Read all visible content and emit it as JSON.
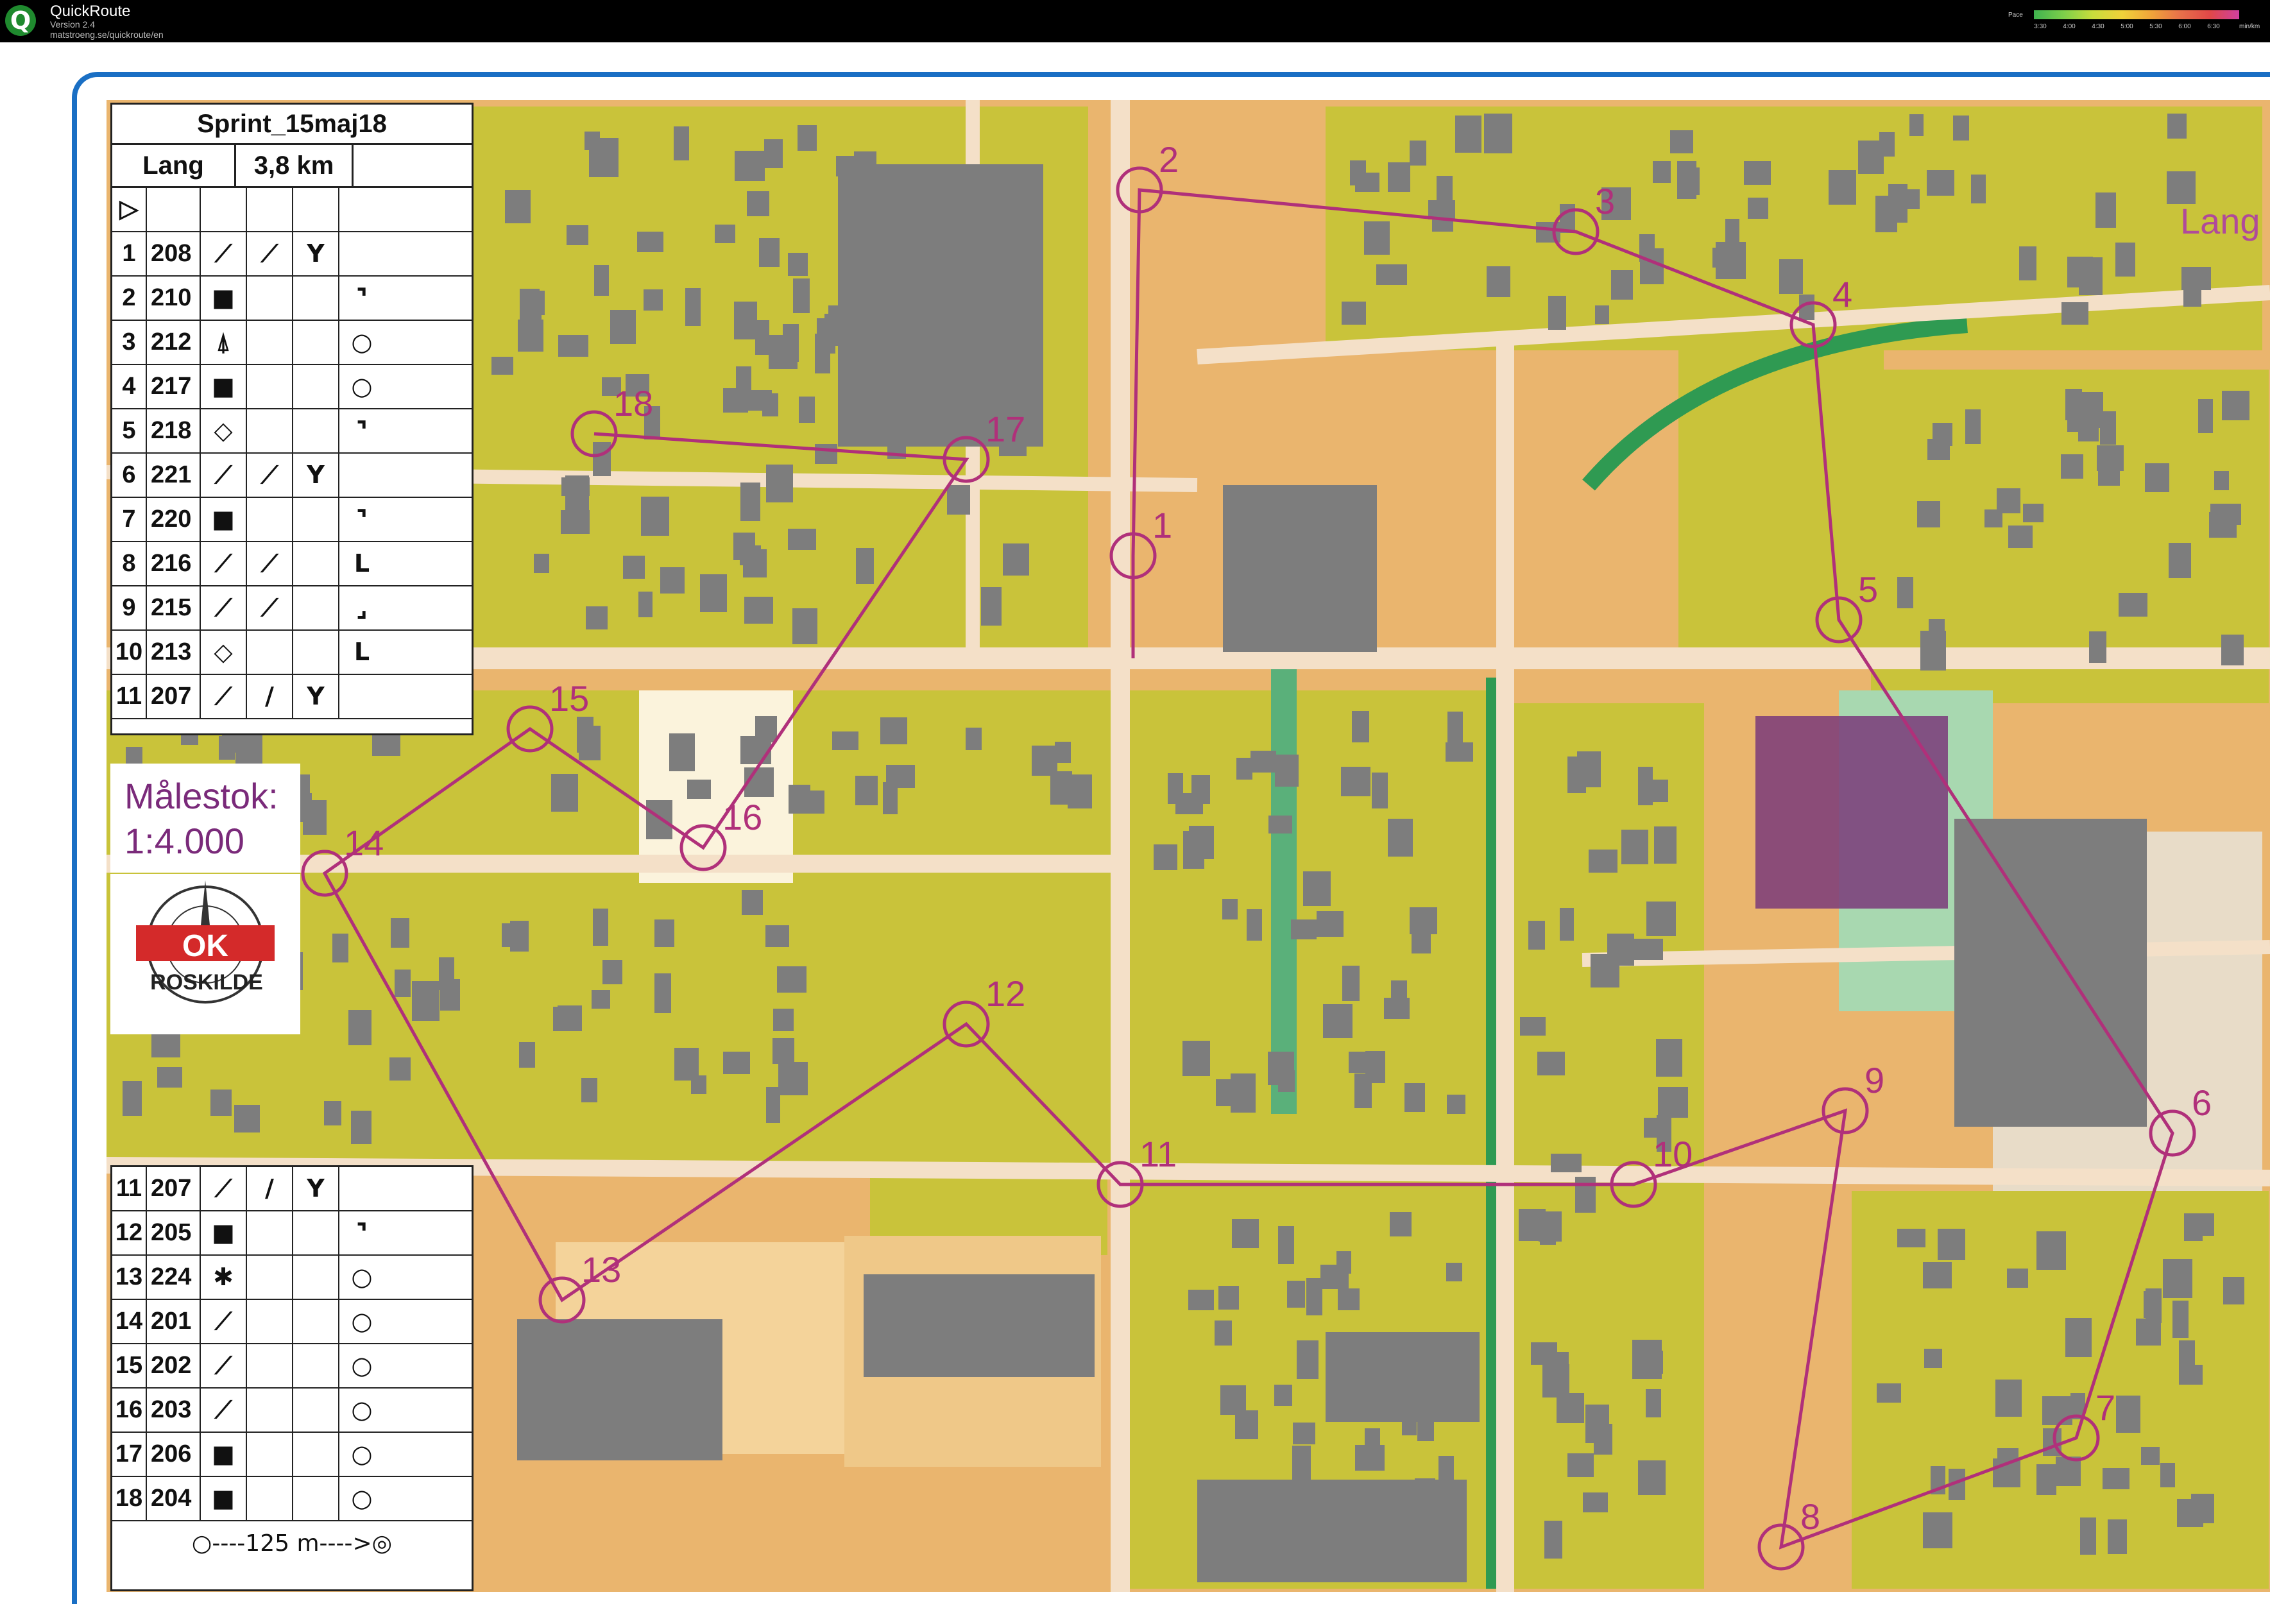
{
  "app": {
    "title": "QuickRoute",
    "version": "Version 2.4",
    "url": "matstroeng.se/quickroute/en",
    "logo_letter": "Q"
  },
  "pace_legend": {
    "label": "Pace",
    "ticks": [
      "3:30",
      "4:00",
      "4:30",
      "5:00",
      "5:30",
      "6:00",
      "6:30"
    ],
    "unit": "min/km"
  },
  "map_sheet": {
    "course_label": "Lang",
    "scale_label": "Målestok:",
    "scale_value": "1:4.000",
    "club_name": "ROSKILDE",
    "club_logo_letters": "OK"
  },
  "control_card": {
    "title": "Sprint_15maj18",
    "class": "Lang",
    "distance": "3,8 km",
    "start_symbol": "▷",
    "rows_top": [
      {
        "n": "1",
        "code": "208",
        "s": [
          "⟋",
          "⟋",
          "Y",
          ""
        ]
      },
      {
        "n": "2",
        "code": "210",
        "s": [
          "■",
          "",
          "",
          "⌝"
        ]
      },
      {
        "n": "3",
        "code": "212",
        "s": [
          "⍋",
          "",
          "",
          "○"
        ]
      },
      {
        "n": "4",
        "code": "217",
        "s": [
          "■",
          "",
          "",
          "○"
        ]
      },
      {
        "n": "5",
        "code": "218",
        "s": [
          "◇",
          "",
          "",
          "⌝"
        ]
      },
      {
        "n": "6",
        "code": "221",
        "s": [
          "⟋",
          "⟋",
          "Y",
          ""
        ]
      },
      {
        "n": "7",
        "code": "220",
        "s": [
          "■",
          "",
          "",
          "⌝"
        ]
      },
      {
        "n": "8",
        "code": "216",
        "s": [
          "⟋",
          "⟋",
          "",
          "L"
        ]
      },
      {
        "n": "9",
        "code": "215",
        "s": [
          "⟋",
          "⟋",
          "",
          "⌟"
        ]
      },
      {
        "n": "10",
        "code": "213",
        "s": [
          "◇",
          "",
          "",
          "L"
        ]
      },
      {
        "n": "11",
        "code": "207",
        "s": [
          "⟋",
          "/",
          "Y",
          ""
        ]
      }
    ],
    "rows_bottom": [
      {
        "n": "11",
        "code": "207",
        "s": [
          "⟋",
          "/",
          "Y",
          ""
        ]
      },
      {
        "n": "12",
        "code": "205",
        "s": [
          "■",
          "",
          "",
          "⌝"
        ]
      },
      {
        "n": "13",
        "code": "224",
        "s": [
          "✱",
          "",
          "",
          "○"
        ]
      },
      {
        "n": "14",
        "code": "201",
        "s": [
          "⟋",
          "",
          "",
          "○"
        ]
      },
      {
        "n": "15",
        "code": "202",
        "s": [
          "⟋",
          "",
          "",
          "○"
        ]
      },
      {
        "n": "16",
        "code": "203",
        "s": [
          "⟋",
          "",
          "",
          "○"
        ]
      },
      {
        "n": "17",
        "code": "206",
        "s": [
          "■",
          "",
          "",
          "○"
        ]
      },
      {
        "n": "18",
        "code": "204",
        "s": [
          "■",
          "",
          "",
          "○"
        ]
      }
    ],
    "finish_text": "○----125 m---->◎"
  },
  "controls": [
    {
      "label": "1"
    },
    {
      "label": "2"
    },
    {
      "label": "3"
    },
    {
      "label": "4"
    },
    {
      "label": "5"
    },
    {
      "label": "6"
    },
    {
      "label": "7"
    },
    {
      "label": "8"
    },
    {
      "label": "9"
    },
    {
      "label": "10"
    },
    {
      "label": "11"
    },
    {
      "label": "12"
    },
    {
      "label": "13"
    },
    {
      "label": "14"
    },
    {
      "label": "15"
    },
    {
      "label": "16"
    },
    {
      "label": "17"
    },
    {
      "label": "18"
    }
  ],
  "colors": {
    "course": "#b0307a",
    "frame": "#1a6fc4",
    "green": "#2f9a52",
    "building": "#7d7d7d",
    "olive": "#c9c33a",
    "open": "#eab56e"
  }
}
